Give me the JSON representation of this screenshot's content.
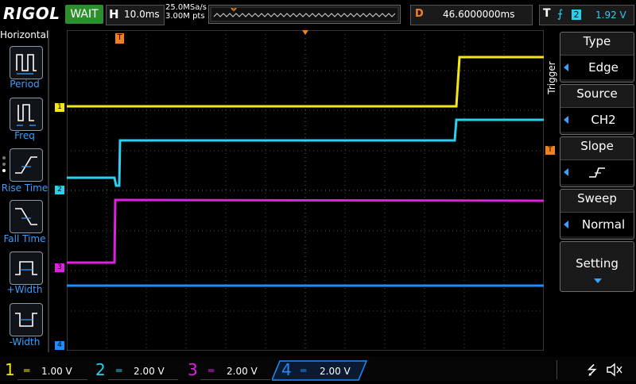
{
  "header": {
    "brand": "RIGOL",
    "status": "WAIT",
    "h_label": "H",
    "timebase": "10.0ms",
    "sample_rate": "25.0MSa/s",
    "mem_depth": "3.00M pts",
    "mem_trigger_marker": "T",
    "d_label": "D",
    "delay": "46.6000000ms",
    "trig_label": "T",
    "trig_channel": "2",
    "trig_level": "1.92 V"
  },
  "left_menu": {
    "title": "Horizontal",
    "items": [
      {
        "label": "Period",
        "icon": "period-icon"
      },
      {
        "label": "Freq",
        "icon": "freq-icon"
      },
      {
        "label": "Rise Time",
        "icon": "rise-time-icon"
      },
      {
        "label": "Fall Time",
        "icon": "fall-time-icon"
      },
      {
        "label": "+Width",
        "icon": "pos-width-icon"
      },
      {
        "label": "-Width",
        "icon": "neg-width-icon"
      }
    ]
  },
  "right_menu": {
    "section": "Trigger",
    "type_title": "Type",
    "type_value": "Edge",
    "source_title": "Source",
    "source_value": "CH2",
    "slope_title": "Slope",
    "sweep_title": "Sweep",
    "sweep_value": "Normal",
    "setting_title": "Setting"
  },
  "markers": {
    "trigger_pos": "T",
    "trigger_level": "T",
    "ch1": "1",
    "ch2": "2",
    "ch3": "3",
    "ch4": "4"
  },
  "channels": [
    {
      "num": "1",
      "scale": "1.00 V",
      "color": "#f5e614",
      "active": false
    },
    {
      "num": "2",
      "scale": "2.00 V",
      "color": "#2ad0f0",
      "active": false
    },
    {
      "num": "3",
      "scale": "2.00 V",
      "color": "#e020e0",
      "active": false
    },
    {
      "num": "4",
      "scale": "2.00 V",
      "color": "#1e8cff",
      "active": true
    }
  ],
  "colors": {
    "ch1": "#f5e614",
    "ch2": "#2ad0f0",
    "ch3": "#e020e0",
    "ch4": "#1e8cff",
    "trigger": "#f08020",
    "status_bg": "#2c8f2c"
  }
}
